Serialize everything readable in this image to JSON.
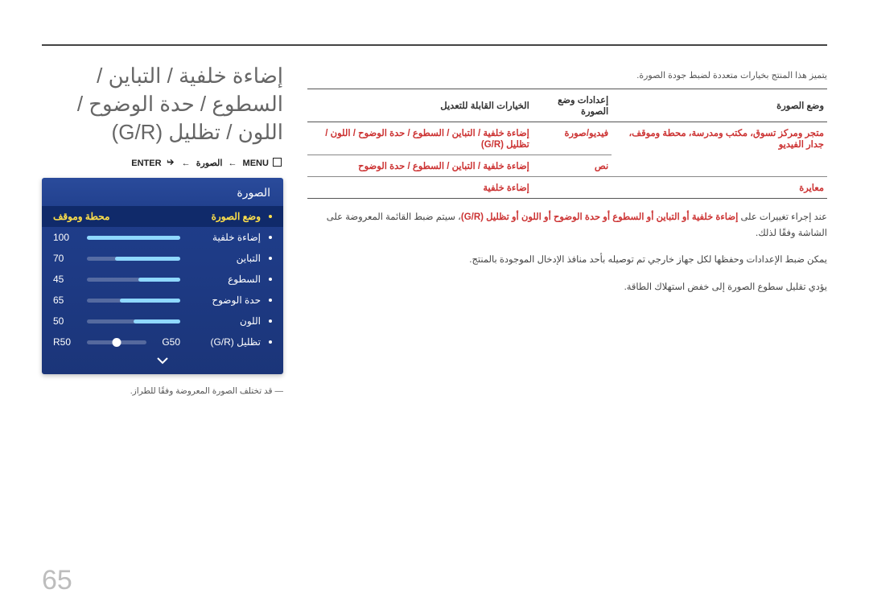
{
  "page_number": "65",
  "heading": "إضاءة خلفية / التباين / السطوع / حدة الوضوح / اللون / تظليل (G/R)",
  "breadcrumb": {
    "menu": "MENU",
    "path": "الصورة",
    "enter": "ENTER"
  },
  "osd": {
    "title": "الصورة",
    "mode_label": "وضع الصورة",
    "mode_value": "محطة وموقف",
    "rows": [
      {
        "label": "إضاءة خلفية",
        "value": "100",
        "pct": 100
      },
      {
        "label": "التباين",
        "value": "70",
        "pct": 70
      },
      {
        "label": "السطوع",
        "value": "45",
        "pct": 45
      },
      {
        "label": "حدة الوضوح",
        "value": "65",
        "pct": 65
      },
      {
        "label": "اللون",
        "value": "50",
        "pct": 50
      }
    ],
    "tint": {
      "label": "تظليل (G/R)",
      "g": "G50",
      "r": "R50",
      "pos": 50
    }
  },
  "osd_note": "قد تختلف الصورة المعروضة وفقًا للطراز.",
  "intro": "يتميز هذا المنتج بخيارات متعددة لضبط جودة الصورة.",
  "table": {
    "headers": [
      "وضع الصورة",
      "إعدادات وضع الصورة",
      "الخيارات القابلة للتعديل"
    ],
    "rows": [
      {
        "c1": "متجر ومركز تسوق، مكتب ومدرسة، محطة وموقف، جدار الفيديو",
        "c2": "فيديو/صورة",
        "c3_red": "إضاءة خلفية / التباين / السطوع / حدة الوضوح / اللون / تظليل (G/R)"
      },
      {
        "c1": "",
        "c2": "نص",
        "c3_red": "إضاءة خلفية / التباين / السطوع / حدة الوضوح"
      },
      {
        "c1": "معايرة",
        "c2": "",
        "c3_red": "إضاءة خلفية"
      }
    ]
  },
  "paras": [
    {
      "pre": "عند إجراء تغييرات على ",
      "terms": "إضاءة خلفية أو التباين أو السطوع أو حدة الوضوح أو اللون أو تظليل (G/R)",
      "post": "، سيتم ضبط القائمة المعروضة على الشاشة وفقًا لذلك."
    },
    {
      "text": "يمكن ضبط الإعدادات وحفظها لكل جهاز خارجي تم توصيله بأحد منافذ الإدخال الموجودة بالمنتج."
    },
    {
      "text": "يؤدي تقليل سطوع الصورة إلى خفض استهلاك الطاقة."
    }
  ]
}
